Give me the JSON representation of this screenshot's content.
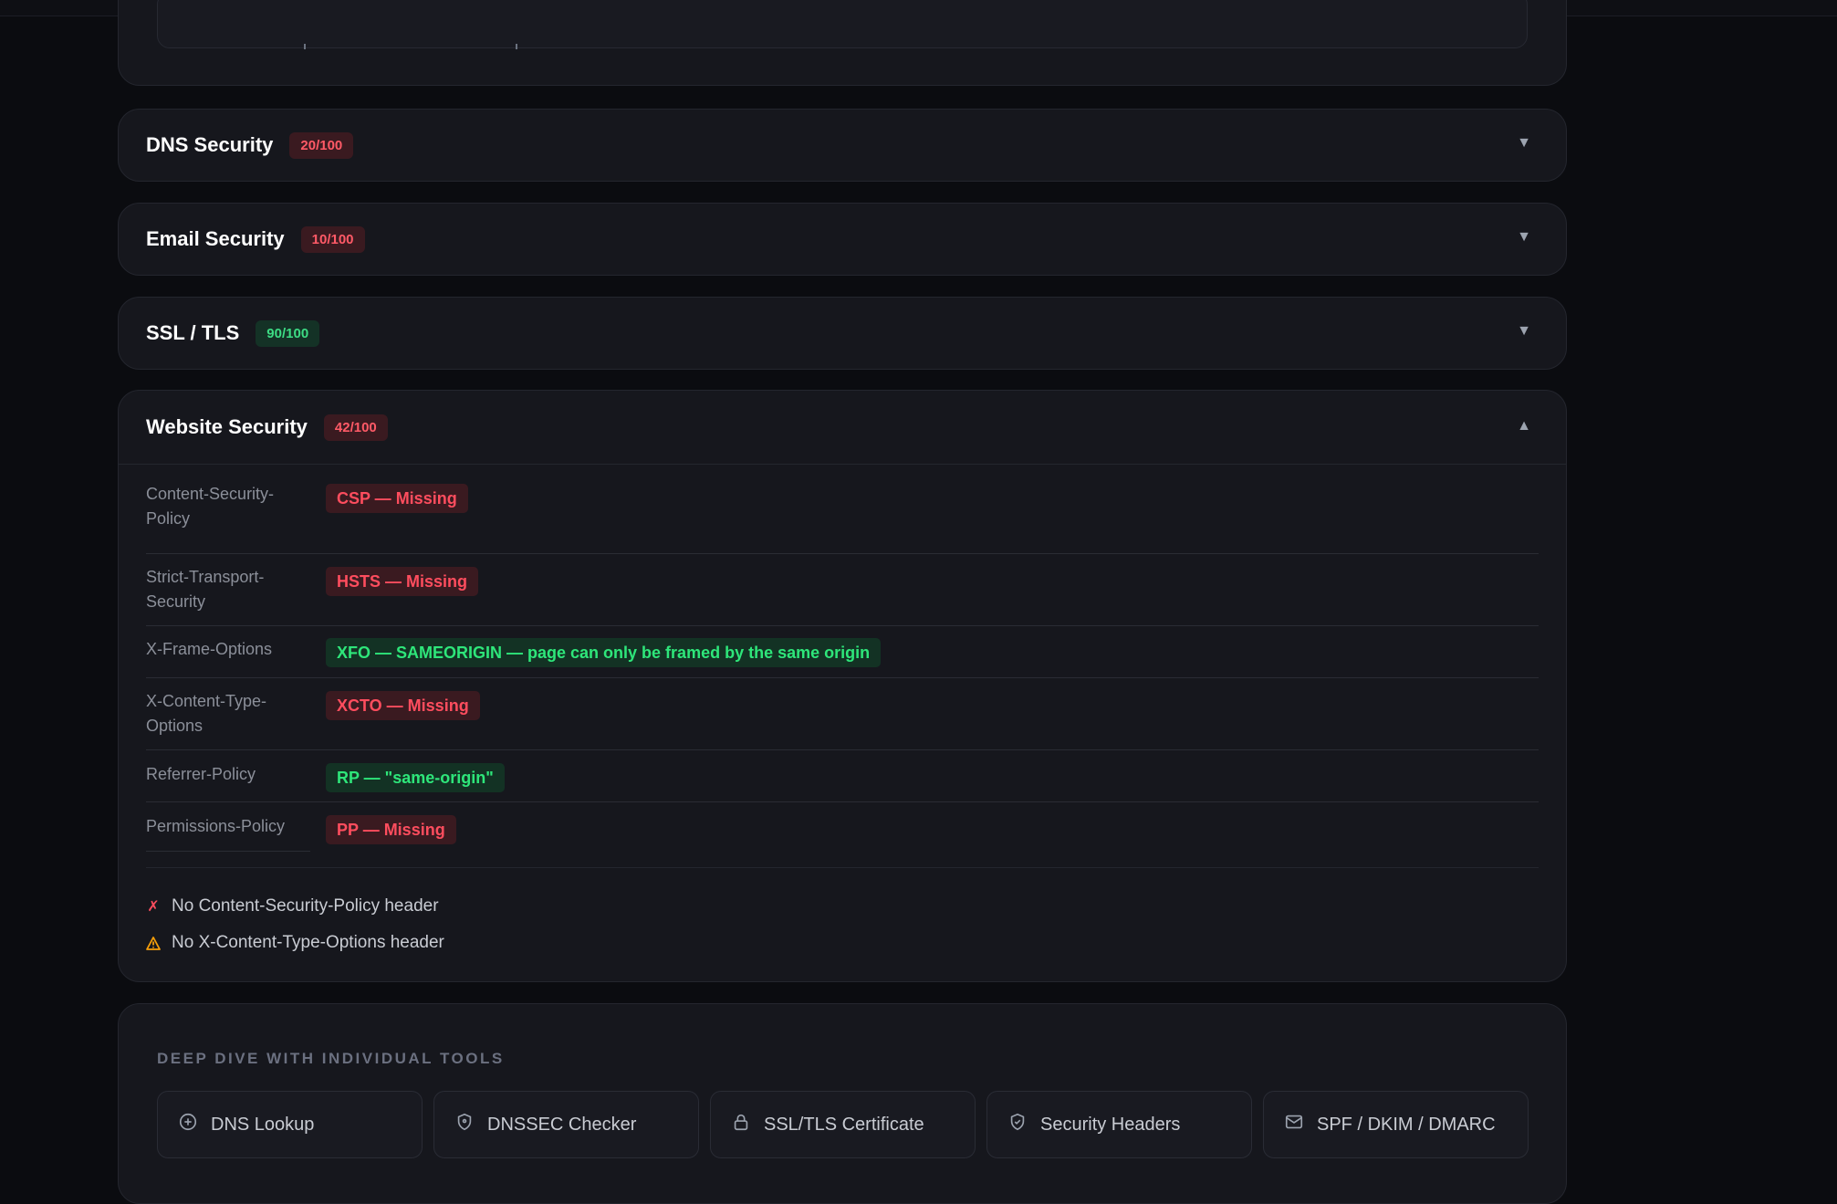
{
  "sections": [
    {
      "title": "DNS Security",
      "score": "20/100",
      "status": "bad"
    },
    {
      "title": "Email Security",
      "score": "10/100",
      "status": "bad"
    },
    {
      "title": "SSL / TLS",
      "score": "90/100",
      "status": "good"
    }
  ],
  "website": {
    "title": "Website Security",
    "score": "42/100",
    "headers": [
      {
        "label": "Content-Security-Policy",
        "value": "CSP — Missing",
        "status": "bad"
      },
      {
        "label": "Strict-Transport-Security",
        "value": "HSTS — Missing",
        "status": "bad"
      },
      {
        "label": "X-Frame-Options",
        "value": "XFO — SAMEORIGIN — page can only be framed by the same origin",
        "status": "good"
      },
      {
        "label": "X-Content-Type-Options",
        "value": "XCTO — Missing",
        "status": "bad"
      },
      {
        "label": "Referrer-Policy",
        "value": "RP — \"same-origin\"",
        "status": "good"
      },
      {
        "label": "Permissions-Policy",
        "value": "PP — Missing",
        "status": "bad"
      }
    ],
    "issues": [
      {
        "icon": "x-mark-icon",
        "text": "No Content-Security-Policy header",
        "severity": "error"
      },
      {
        "icon": "warning-icon",
        "text": "No X-Content-Type-Options header",
        "severity": "warning"
      }
    ]
  },
  "tools": {
    "title": "DEEP DIVE WITH INDIVIDUAL TOOLS",
    "items": [
      {
        "label": "DNS Lookup",
        "icon": "plus-circle-icon"
      },
      {
        "label": "DNSSEC Checker",
        "icon": "shield-icon"
      },
      {
        "label": "SSL/TLS Certificate",
        "icon": "lock-icon"
      },
      {
        "label": "Security Headers",
        "icon": "shield-check-icon"
      },
      {
        "label": "SPF / DKIM / DMARC",
        "icon": "mail-icon"
      }
    ]
  },
  "colors": {
    "background": "#0b0c10",
    "card": "#16171d",
    "bad": "#ff4d5e",
    "good": "#2ee67a",
    "warning": "#f59e0b"
  }
}
